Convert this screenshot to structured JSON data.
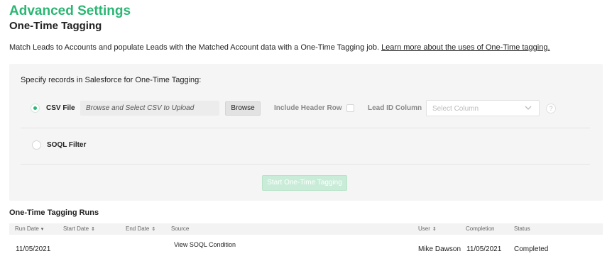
{
  "page": {
    "title": "Advanced Settings",
    "subtitle": "One-Time Tagging",
    "description": "Match Leads to Accounts and populate Leads with the Matched Account data with a One-Time Tagging job.",
    "learn_more_link": "Learn more about the uses of One-Time tagging."
  },
  "panel": {
    "title": "Specify records in Salesforce for One-Time Tagging:",
    "csv": {
      "label": "CSV File",
      "selected": true,
      "file_placeholder": "Browse and Select CSV to Upload",
      "browse_label": "Browse",
      "header_row_label": "Include Header Row",
      "header_row_checked": false,
      "lead_id_label": "Lead ID Column",
      "lead_id_placeholder": "Select Column",
      "help_glyph": "?"
    },
    "soql": {
      "label": "SOQL Filter",
      "selected": false
    },
    "start_button_label": "Start One-Time Tagging",
    "accent_color": "#2bb673"
  },
  "runs": {
    "title": "One-Time Tagging Runs",
    "columns": [
      {
        "label": "Run Date",
        "sort_icon": "caret-down-icon",
        "glyph": "▾"
      },
      {
        "label": "Start Date",
        "sort_icon": "sort-icon",
        "glyph": "⇕"
      },
      {
        "label": "End Date",
        "sort_icon": "sort-icon",
        "glyph": "⇕"
      },
      {
        "label": "Source"
      },
      {
        "label": "User",
        "sort_icon": "sort-icon",
        "glyph": "⇕"
      },
      {
        "label": "Completion"
      },
      {
        "label": "Status"
      }
    ],
    "rows": [
      {
        "run_date": "11/05/2021",
        "start_date": "",
        "end_date": "",
        "source": "View SOQL Condition",
        "user": "Mike Dawson",
        "completion": "11/05/2021",
        "status": "Completed"
      }
    ]
  }
}
